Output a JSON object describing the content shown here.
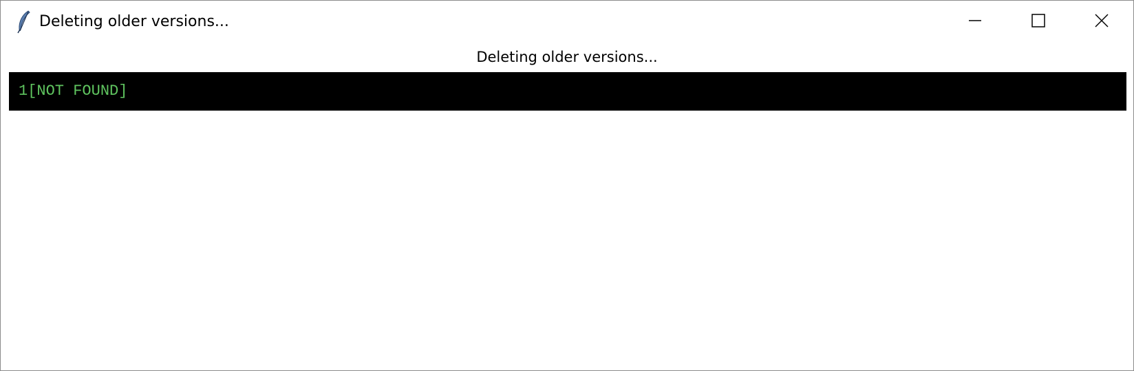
{
  "window": {
    "title": "Deleting older versions...",
    "icon": "feather-icon",
    "controls": {
      "minimize_icon": "minimize-icon",
      "maximize_icon": "maximize-icon",
      "close_icon": "close-icon"
    }
  },
  "main": {
    "status_label": "Deleting older versions...",
    "console": {
      "lines": [
        "1[NOT FOUND]"
      ],
      "background_color": "#000000",
      "text_color": "#5fc45f"
    }
  }
}
